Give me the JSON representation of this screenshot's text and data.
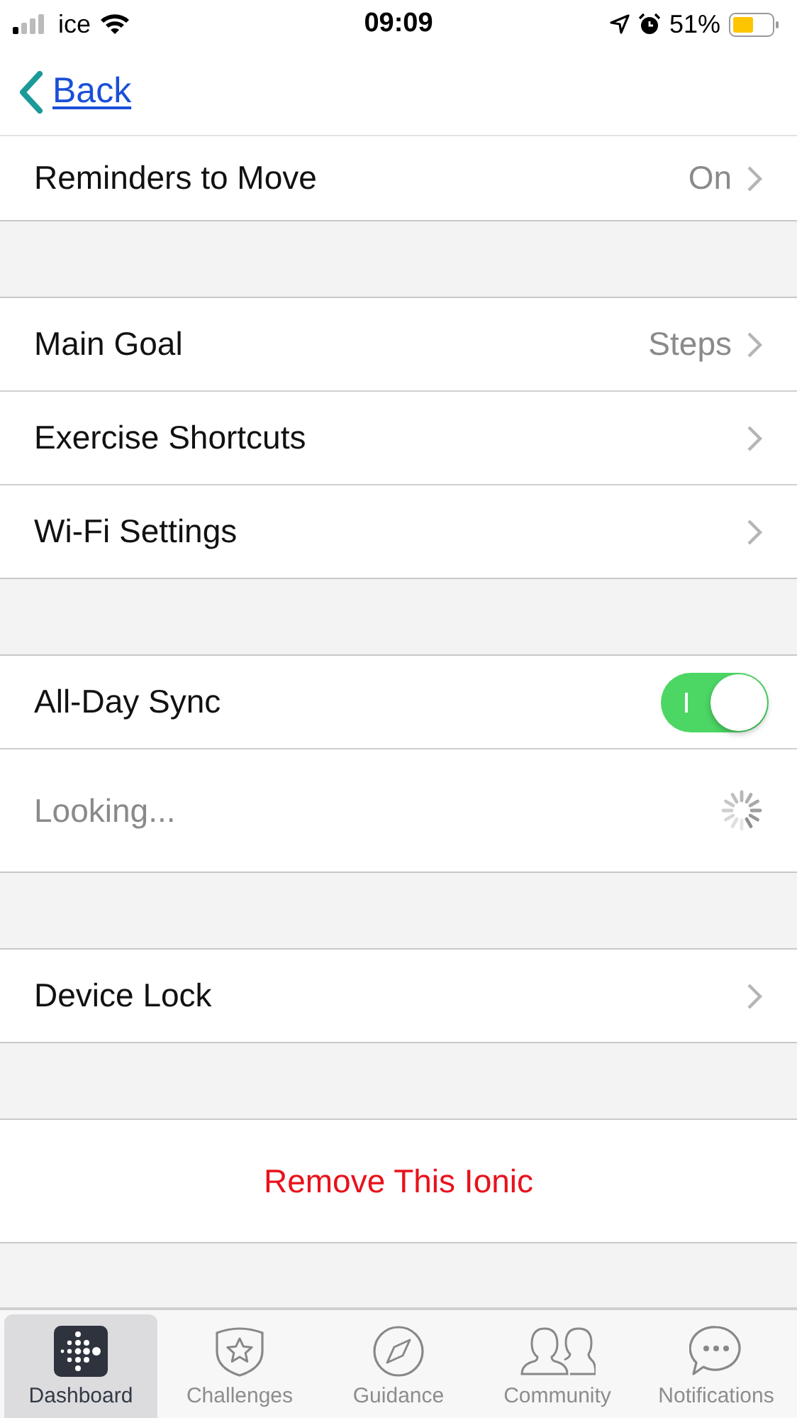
{
  "status_bar": {
    "carrier": "ice",
    "time": "09:09",
    "battery": "51%"
  },
  "nav": {
    "back": "Back"
  },
  "groups": [
    {
      "rows": [
        {
          "kind": "link",
          "label": "Reminders to Move",
          "value": "On"
        }
      ]
    },
    {
      "rows": [
        {
          "kind": "link",
          "label": "Main Goal",
          "value": "Steps"
        },
        {
          "kind": "link",
          "label": "Exercise Shortcuts"
        },
        {
          "kind": "link",
          "label": "Wi-Fi Settings"
        }
      ]
    },
    {
      "rows": [
        {
          "kind": "toggle",
          "label": "All-Day Sync",
          "on": true
        },
        {
          "kind": "loading",
          "label": "Looking..."
        }
      ]
    },
    {
      "rows": [
        {
          "kind": "link",
          "label": "Device Lock"
        }
      ]
    },
    {
      "rows": [
        {
          "kind": "action",
          "label": "Remove This Ionic"
        }
      ]
    }
  ],
  "tabs": [
    {
      "label": "Dashboard",
      "kind": "dashboard",
      "selected": true
    },
    {
      "label": "Challenges",
      "kind": "badge",
      "selected": false
    },
    {
      "label": "Guidance",
      "kind": "compass",
      "selected": false
    },
    {
      "label": "Community",
      "kind": "people",
      "selected": false
    },
    {
      "label": "Notifications",
      "kind": "chat",
      "selected": false
    }
  ]
}
